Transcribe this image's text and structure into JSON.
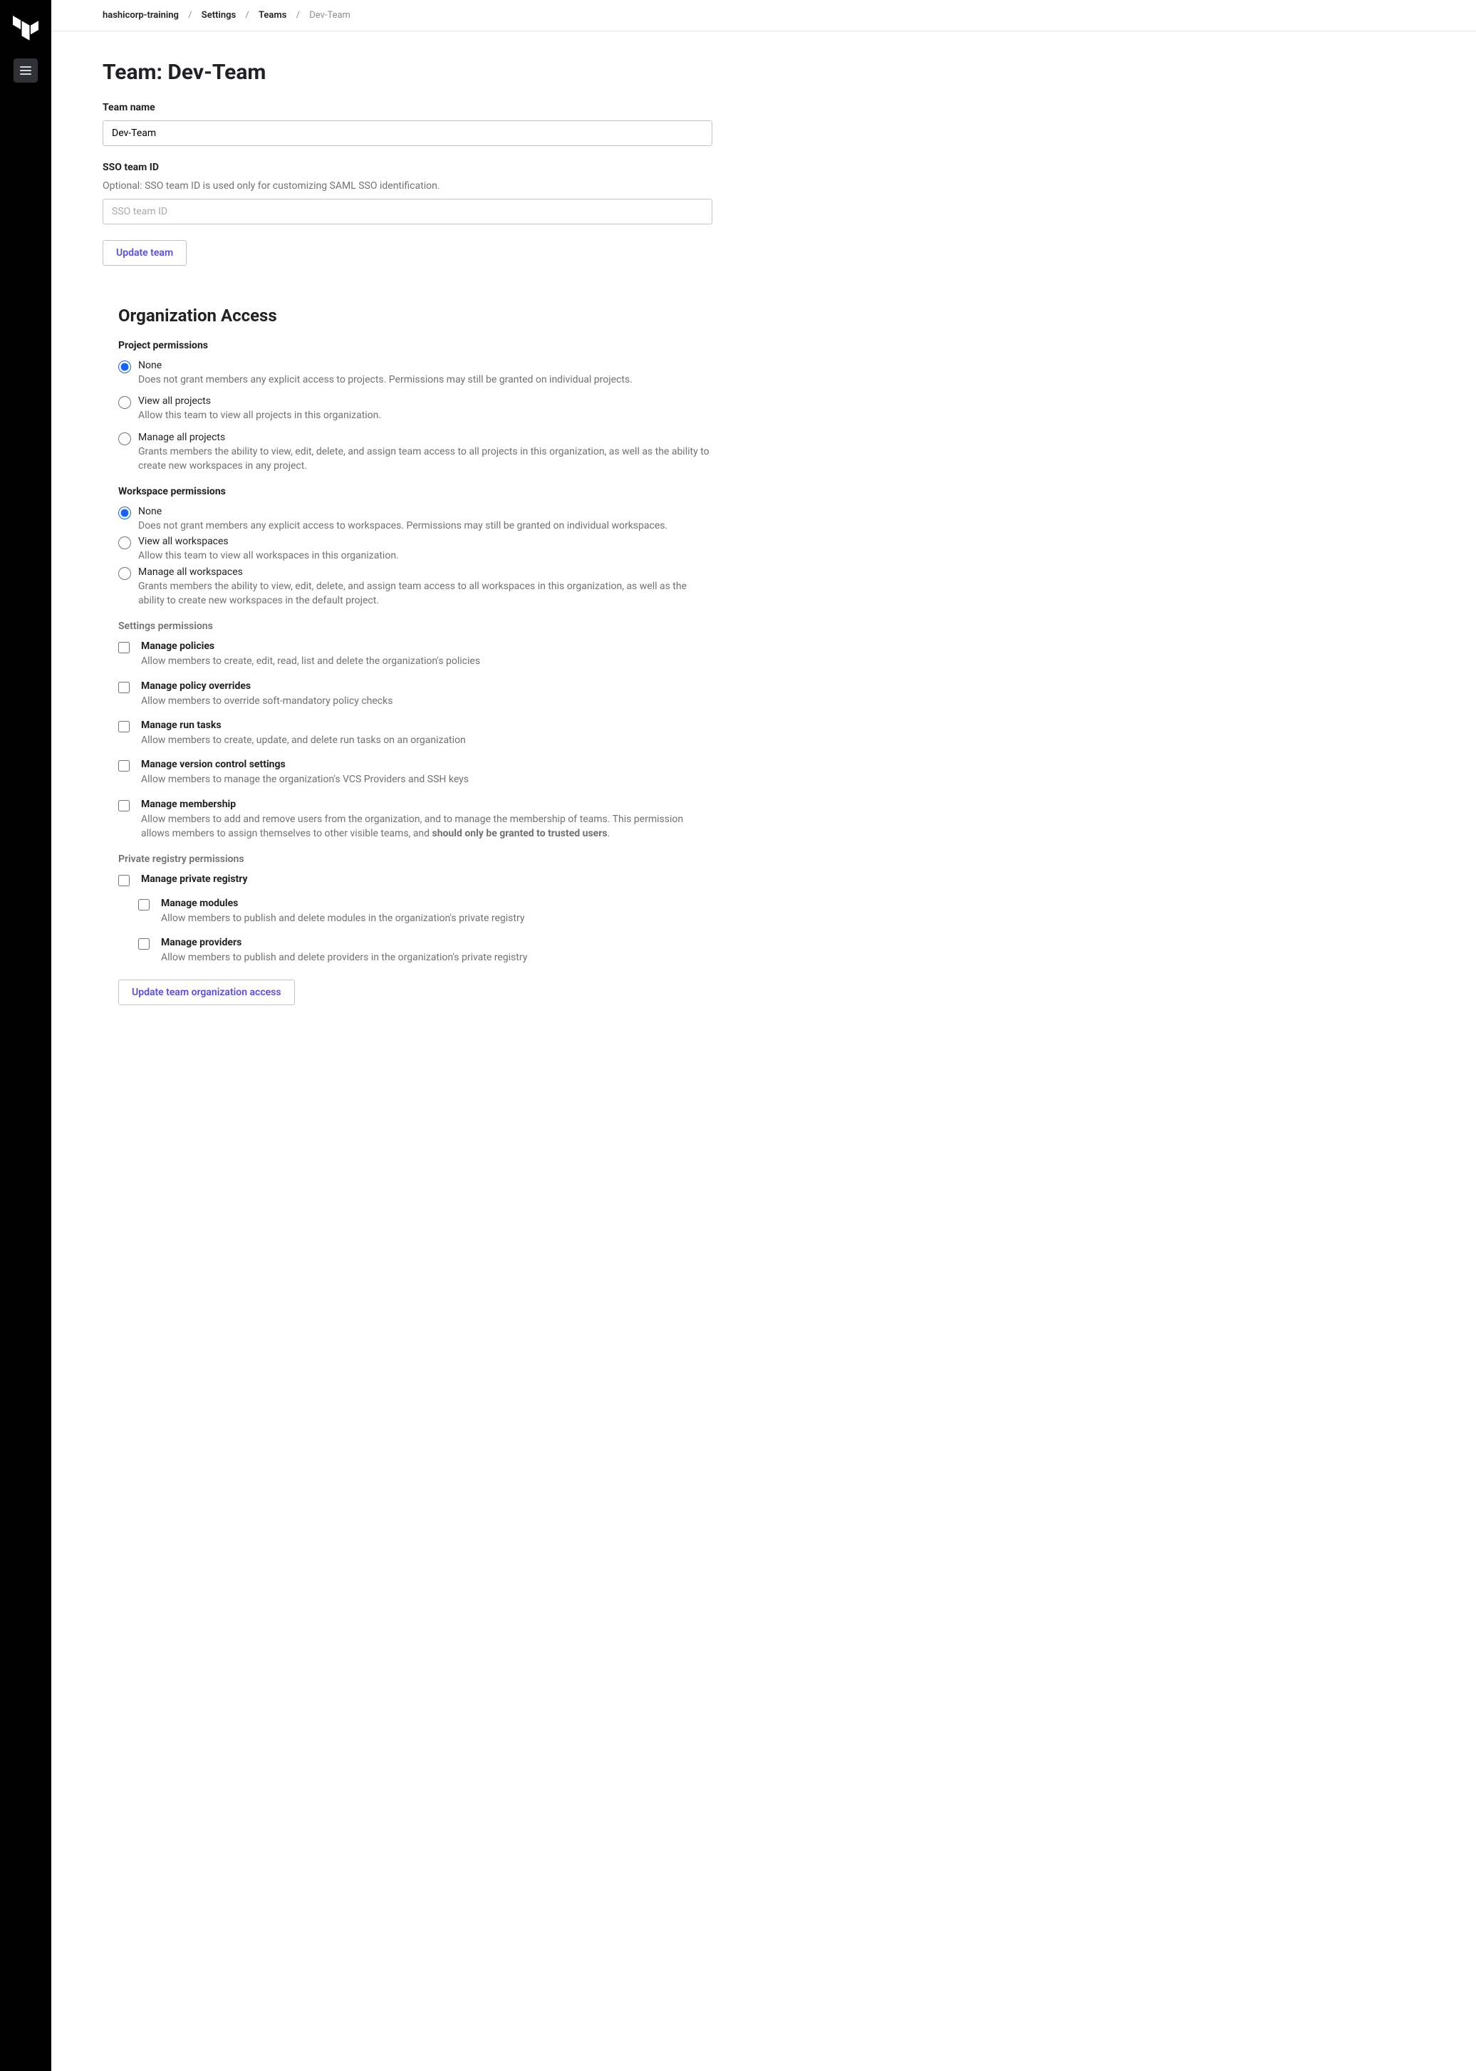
{
  "breadcrumbs": {
    "org": "hashicorp-training",
    "settings": "Settings",
    "teams": "Teams",
    "current": "Dev-Team"
  },
  "page_title": "Team: Dev-Team",
  "team_name": {
    "label": "Team name",
    "value": "Dev-Team"
  },
  "sso": {
    "label": "SSO team ID",
    "help": "Optional: SSO team ID is used only for customizing SAML SSO identification.",
    "placeholder": "SSO team ID"
  },
  "update_team_btn": "Update team",
  "org_access_heading": "Organization Access",
  "project_permissions": {
    "heading": "Project permissions",
    "options": [
      {
        "label": "None",
        "desc": "Does not grant members any explicit access to projects. Permissions may still be granted on individual projects.",
        "selected": true
      },
      {
        "label": "View all projects",
        "desc": "Allow this team to view all projects in this organization.",
        "selected": false
      },
      {
        "label": "Manage all projects",
        "desc": "Grants members the ability to view, edit, delete, and assign team access to all projects in this organization, as well as the ability to create new workspaces in any project.",
        "selected": false
      }
    ]
  },
  "workspace_permissions": {
    "heading": "Workspace permissions",
    "options": [
      {
        "label": "None",
        "desc": "Does not grant members any explicit access to workspaces. Permissions may still be granted on individual workspaces.",
        "selected": true
      },
      {
        "label": "View all workspaces",
        "desc": "Allow this team to view all workspaces in this organization.",
        "selected": false
      },
      {
        "label": "Manage all workspaces",
        "desc": "Grants members the ability to view, edit, delete, and assign team access to all workspaces in this organization, as well as the ability to create new workspaces in the default project.",
        "selected": false
      }
    ]
  },
  "settings_permissions": {
    "heading": "Settings permissions",
    "items": [
      {
        "label": "Manage policies",
        "desc": "Allow members to create, edit, read, list and delete the organization's policies"
      },
      {
        "label": "Manage policy overrides",
        "desc": "Allow members to override soft-mandatory policy checks"
      },
      {
        "label": "Manage run tasks",
        "desc": "Allow members to create, update, and delete run tasks on an organization"
      },
      {
        "label": "Manage version control settings",
        "desc": "Allow members to manage the organization's VCS Providers and SSH keys"
      }
    ],
    "membership": {
      "label": "Manage membership",
      "desc_prefix": "Allow members to add and remove users from the organization, and to manage the membership of teams. This permission allows members to assign themselves to other visible teams, and ",
      "desc_bold": "should only be granted to trusted users",
      "desc_suffix": "."
    }
  },
  "registry_permissions": {
    "heading": "Private registry permissions",
    "parent": {
      "label": "Manage private registry"
    },
    "children": [
      {
        "label": "Manage modules",
        "desc": "Allow members to publish and delete modules in the organization's private registry"
      },
      {
        "label": "Manage providers",
        "desc": "Allow members to publish and delete providers in the organization's private registry"
      }
    ]
  },
  "update_access_btn": "Update team organization access"
}
